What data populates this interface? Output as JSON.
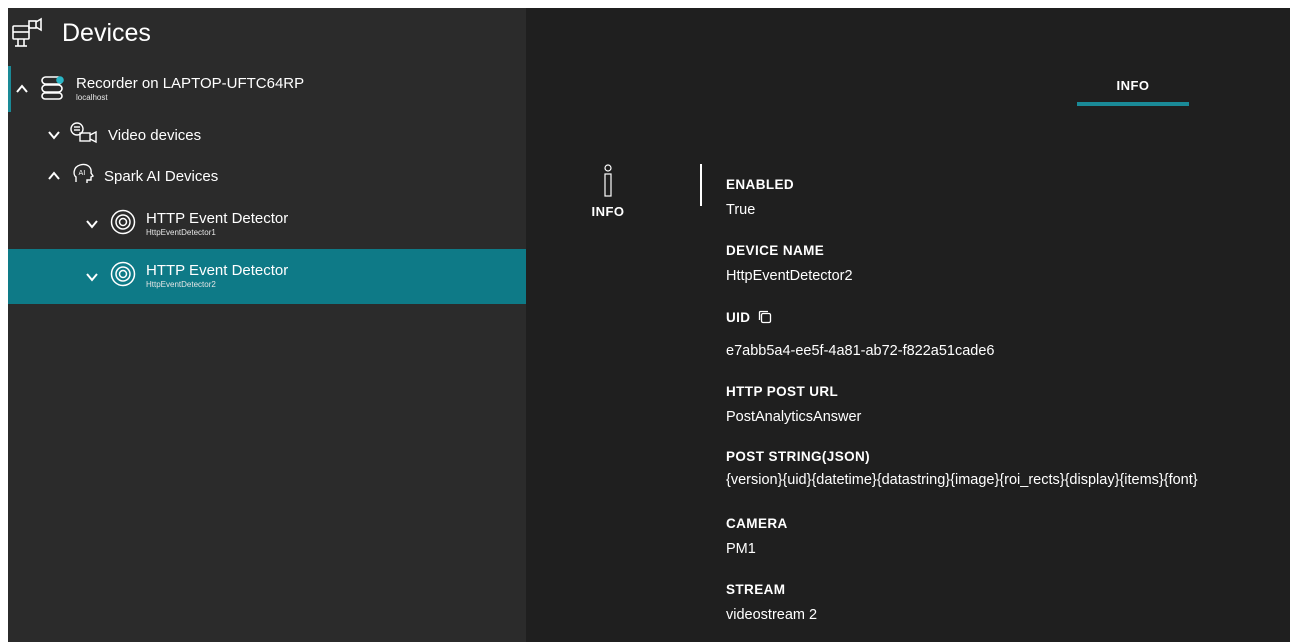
{
  "header": {
    "title": "Devices",
    "icon": "devices-icon"
  },
  "tree": {
    "recorder": {
      "label": "Recorder on LAPTOP-UFTC64RP",
      "sub": "localhost",
      "icon": "server-icon",
      "expanded": true
    },
    "video_devices": {
      "label": "Video devices",
      "icon": "video-devices-icon",
      "expanded": false
    },
    "spark": {
      "label": "Spark AI Devices",
      "icon": "ai-head-icon",
      "expanded": true
    },
    "detectors": [
      {
        "label": "HTTP Event Detector",
        "sub": "HttpEventDetector1",
        "icon": "target-icon",
        "selected": false
      },
      {
        "label": "HTTP Event Detector",
        "sub": "HttpEventDetector2",
        "icon": "target-icon",
        "selected": true
      }
    ]
  },
  "tabs": {
    "active": "INFO"
  },
  "side_info": {
    "label": "INFO",
    "icon": "info-icon"
  },
  "fields": [
    {
      "label": "ENABLED",
      "value": "True"
    },
    {
      "label": "DEVICE NAME",
      "value": "HttpEventDetector2"
    },
    {
      "label": "UID",
      "value": "e7abb5a4-ee5f-4a81-ab72-f822a51cade6",
      "icon": "copy-icon"
    },
    {
      "label": "HTTP POST URL",
      "value": "PostAnalyticsAnswer"
    },
    {
      "label": "POST STRING(JSON)",
      "value": "{version}{uid}{datetime}{datastring}{image}{roi_rects}{display}{items}{font}"
    },
    {
      "label": "CAMERA",
      "value": "PM1"
    },
    {
      "label": "STREAM",
      "value": "videostream 2"
    }
  ],
  "colors": {
    "accent": "#0e7a87",
    "panel": "#2b2b2b",
    "content": "#1f1f1f"
  }
}
